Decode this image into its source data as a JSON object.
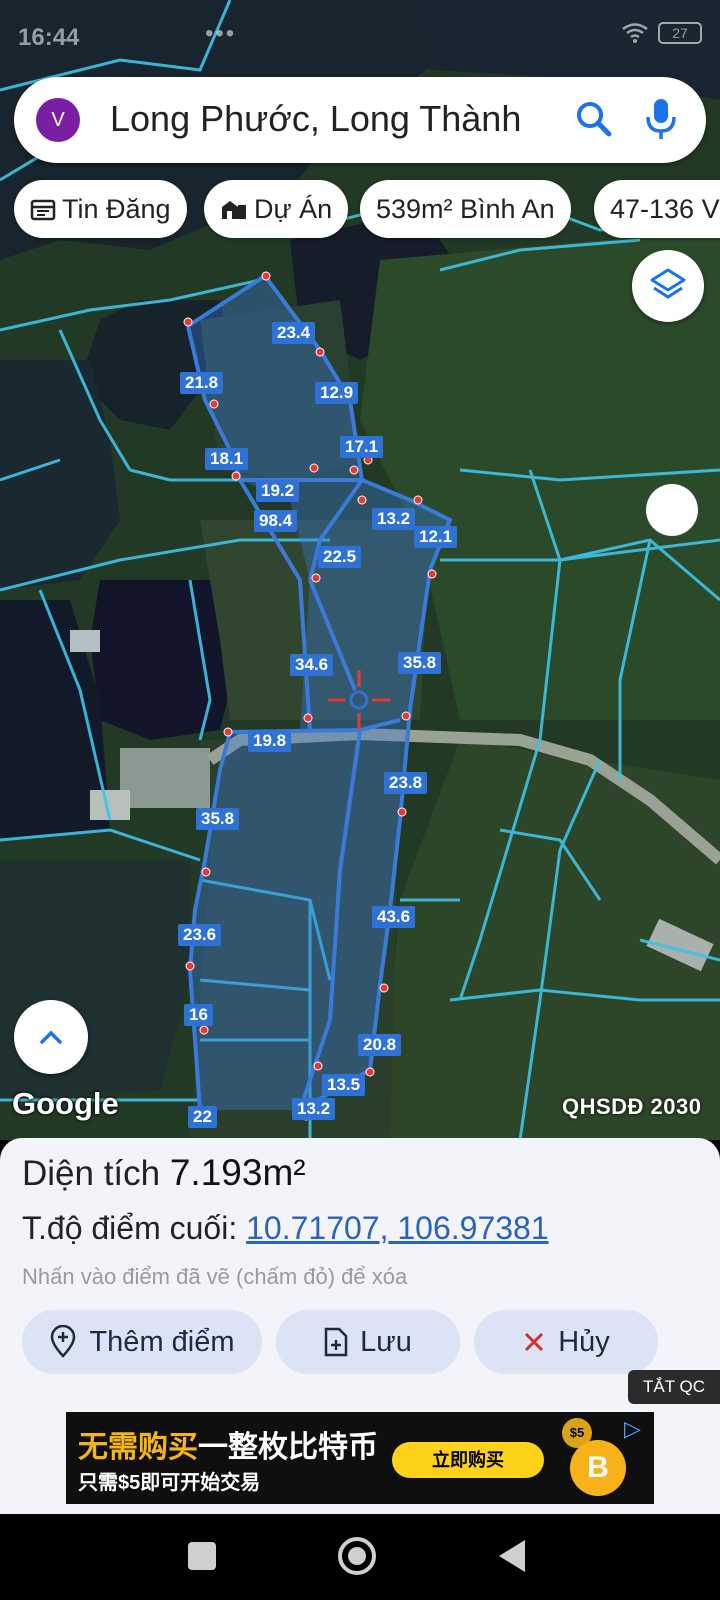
{
  "status": {
    "time": "16:44",
    "dots": "•••",
    "battery": "27"
  },
  "search": {
    "avatar": "V",
    "query": "Long Phước, Long Thành",
    "search_icon": "search-icon",
    "mic_icon": "mic-icon"
  },
  "chips": [
    {
      "label": "Tin Đăng",
      "icon": "calendar-icon"
    },
    {
      "label": "Dự Án",
      "icon": "building-icon"
    },
    {
      "label": "539m² Bình An"
    },
    {
      "label": "47-136 V"
    }
  ],
  "map": {
    "google_logo": "Google",
    "plan_label": "QHSDĐ 2030",
    "measurements": [
      "23.4",
      "21.8",
      "12.9",
      "17.1",
      "18.1",
      "19.2",
      "98.4",
      "13.2",
      "12.1",
      "22.5",
      "34.6",
      "35.8",
      "19.8",
      "23.8",
      "35.8",
      "43.6",
      "23.6",
      "16",
      "20.8",
      "13.5",
      "13.2",
      "22"
    ]
  },
  "panel": {
    "area_label": "Diện tích",
    "area_value": "7.193m²",
    "coord_label": "T.độ điểm cuối:",
    "coord_value": "10.71707, 106.97381",
    "hint": "Nhấn vào điểm đã vẽ (chấm đỏ) để xóa",
    "add_point": "Thêm điểm",
    "save": "Lưu",
    "cancel": "Hủy",
    "hide_ads": "TẮT QC"
  },
  "ad": {
    "line1_a": "无需购买",
    "line1_b": "一整枚比特币",
    "line2": "只需$5即可开始交易",
    "cta": "立即购买",
    "badge": "$5",
    "coin": "B"
  },
  "colors": {
    "parcel_line": "#3ec3e8",
    "polygon": "#3a7ad8",
    "label_bg": "#2f72d6",
    "accent": "#2b63b8"
  }
}
